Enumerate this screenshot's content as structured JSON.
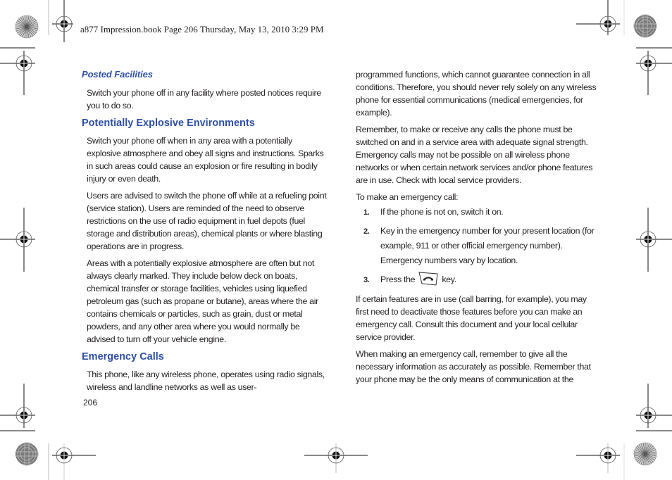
{
  "header": {
    "text": "a877 Impression.book  Page 206  Thursday, May 13, 2010  3:29 PM"
  },
  "left_column": {
    "posted_facilities": {
      "heading": "Posted Facilities",
      "paragraphs": [
        "Switch your phone off in any facility where posted notices require you to do so."
      ]
    },
    "explosive_env": {
      "heading": "Potentially Explosive Environments",
      "paragraphs": [
        "Switch your phone off when in any area with a potentially explosive atmosphere and obey all signs and instructions. Sparks in such areas could cause an explosion or fire resulting in bodily injury or even death.",
        "Users are advised to switch the phone off while at a refueling point (service station). Users are reminded of the need to observe restrictions on the use of radio equipment in fuel depots (fuel storage and distribution areas), chemical plants or where blasting operations are in progress.",
        "Areas with a potentially explosive atmosphere are often but not always clearly marked. They include below deck on boats, chemical transfer or storage facilities, vehicles using liquefied petroleum gas (such as propane or butane), areas where the air contains chemicals or particles, such as grain, dust or metal powders, and any other area where you would normally be advised to turn off your vehicle engine."
      ]
    },
    "emergency_calls": {
      "heading": "Emergency Calls",
      "paragraphs": [
        "This phone, like any wireless phone, operates using radio signals, wireless and landline networks as well as user-"
      ]
    }
  },
  "right_column": {
    "paragraphs_top": [
      "programmed functions, which cannot guarantee connection in all conditions. Therefore, you should never rely solely on any wireless phone for essential communications (medical emergencies, for example).",
      "Remember, to make or receive any calls the phone must be switched on and in a service area with adequate signal strength. Emergency calls may not be possible on all wireless phone networks or when certain network services and/or phone features are in use. Check with local service providers."
    ],
    "steps_intro": "To make an emergency call:",
    "steps": [
      {
        "num": "1.",
        "text": "If the phone is not on, switch it on."
      },
      {
        "num": "2.",
        "text": "Key in the emergency number for your present location (for example, 911 or other official emergency number). Emergency numbers vary by location."
      },
      {
        "num": "3.",
        "text_before": "Press the",
        "icon": "send-key-icon",
        "text_after": "key."
      }
    ],
    "paragraphs_bottom": [
      "If certain features are in use (call barring, for example), you may first need to deactivate those features before you can make an emergency call. Consult this document and your local cellular service provider.",
      "When making an emergency call, remember to give all the necessary information as accurately as possible. Remember that your phone may be the only means of communication at the"
    ]
  },
  "footer": {
    "page_number": "206"
  },
  "colors": {
    "heading_blue": "#2e4fa3",
    "body_text": "#231f20"
  }
}
